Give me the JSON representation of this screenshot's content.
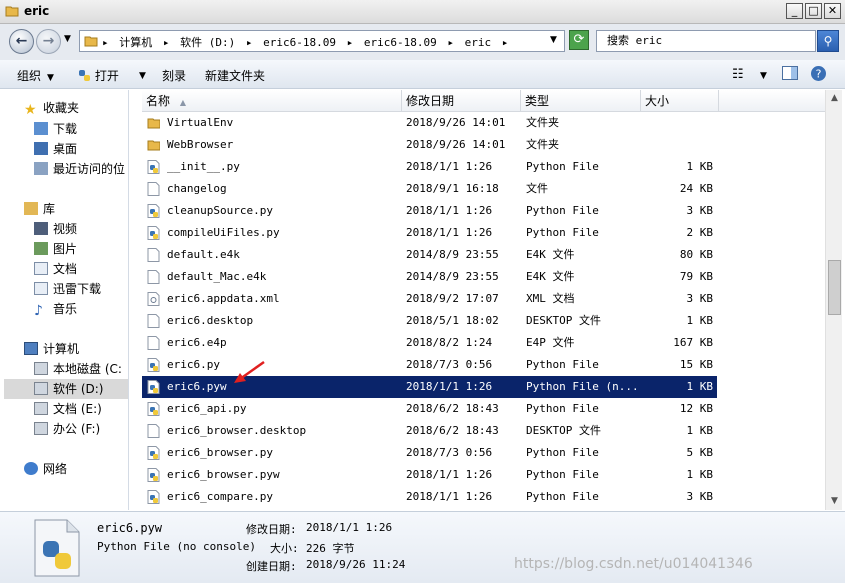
{
  "window": {
    "title": "eric"
  },
  "address": {
    "crumbs": [
      "计算机",
      "软件 (D:)",
      "eric6-18.09",
      "eric6-18.09",
      "eric"
    ],
    "search_placeholder": "搜索 eric"
  },
  "toolbar": {
    "organize": "组织",
    "open": "打开",
    "burn": "刻录",
    "new_folder": "新建文件夹"
  },
  "nav": {
    "favorites": "收藏夹",
    "downloads": "下载",
    "desktop": "桌面",
    "recent": "最近访问的位",
    "libraries": "库",
    "videos": "视频",
    "pictures": "图片",
    "documents": "文档",
    "xunlei": "迅雷下载",
    "music": "音乐",
    "computer": "计算机",
    "local_disk": "本地磁盘 (C:",
    "drive_d": "软件 (D:)",
    "drive_e": "文档 (E:)",
    "drive_f": "办公 (F:)",
    "network": "网络"
  },
  "columns": {
    "name": "名称",
    "modified": "修改日期",
    "type": "类型",
    "size": "大小"
  },
  "files": [
    {
      "name": "VirtualEnv",
      "modified": "2018/9/26 14:01",
      "type": "文件夹",
      "size": "",
      "icon": "folder"
    },
    {
      "name": "WebBrowser",
      "modified": "2018/9/26 14:01",
      "type": "文件夹",
      "size": "",
      "icon": "folder"
    },
    {
      "name": "__init__.py",
      "modified": "2018/1/1 1:26",
      "type": "Python File",
      "size": "1 KB",
      "icon": "python"
    },
    {
      "name": "changelog",
      "modified": "2018/9/1 16:18",
      "type": "文件",
      "size": "24 KB",
      "icon": "doc"
    },
    {
      "name": "cleanupSource.py",
      "modified": "2018/1/1 1:26",
      "type": "Python File",
      "size": "3 KB",
      "icon": "python"
    },
    {
      "name": "compileUiFiles.py",
      "modified": "2018/1/1 1:26",
      "type": "Python File",
      "size": "2 KB",
      "icon": "python"
    },
    {
      "name": "default.e4k",
      "modified": "2014/8/9 23:55",
      "type": "E4K 文件",
      "size": "80 KB",
      "icon": "doc"
    },
    {
      "name": "default_Mac.e4k",
      "modified": "2014/8/9 23:55",
      "type": "E4K 文件",
      "size": "79 KB",
      "icon": "doc"
    },
    {
      "name": "eric6.appdata.xml",
      "modified": "2018/9/2 17:07",
      "type": "XML 文档",
      "size": "3 KB",
      "icon": "xml"
    },
    {
      "name": "eric6.desktop",
      "modified": "2018/5/1 18:02",
      "type": "DESKTOP 文件",
      "size": "1 KB",
      "icon": "doc"
    },
    {
      "name": "eric6.e4p",
      "modified": "2018/8/2 1:24",
      "type": "E4P 文件",
      "size": "167 KB",
      "icon": "doc"
    },
    {
      "name": "eric6.py",
      "modified": "2018/7/3 0:56",
      "type": "Python File",
      "size": "15 KB",
      "icon": "python"
    },
    {
      "name": "eric6.pyw",
      "modified": "2018/1/1 1:26",
      "type": "Python File (n...",
      "size": "1 KB",
      "icon": "pythonw"
    },
    {
      "name": "eric6_api.py",
      "modified": "2018/6/2 18:43",
      "type": "Python File",
      "size": "12 KB",
      "icon": "python"
    },
    {
      "name": "eric6_browser.desktop",
      "modified": "2018/6/2 18:43",
      "type": "DESKTOP 文件",
      "size": "1 KB",
      "icon": "doc"
    },
    {
      "name": "eric6_browser.py",
      "modified": "2018/7/3 0:56",
      "type": "Python File",
      "size": "5 KB",
      "icon": "python"
    },
    {
      "name": "eric6_browser.pyw",
      "modified": "2018/1/1 1:26",
      "type": "Python File",
      "size": "1 KB",
      "icon": "python"
    },
    {
      "name": "eric6_compare.py",
      "modified": "2018/1/1 1:26",
      "type": "Python File",
      "size": "3 KB",
      "icon": "python"
    }
  ],
  "selected_index": 12,
  "details": {
    "filename": "eric6.pyw",
    "filetype": "Python File (no console)",
    "modified_label": "修改日期:",
    "modified_value": "2018/1/1 1:26",
    "size_label": "大小:",
    "size_value": "226 字节",
    "created_label": "创建日期:",
    "created_value": "2018/9/26 11:24"
  },
  "watermark": "https://blog.csdn.net/u014041346",
  "colors": {
    "selection": "#0a246a",
    "annotation_arrow": "#e02020",
    "folder": "#e8b84a"
  }
}
